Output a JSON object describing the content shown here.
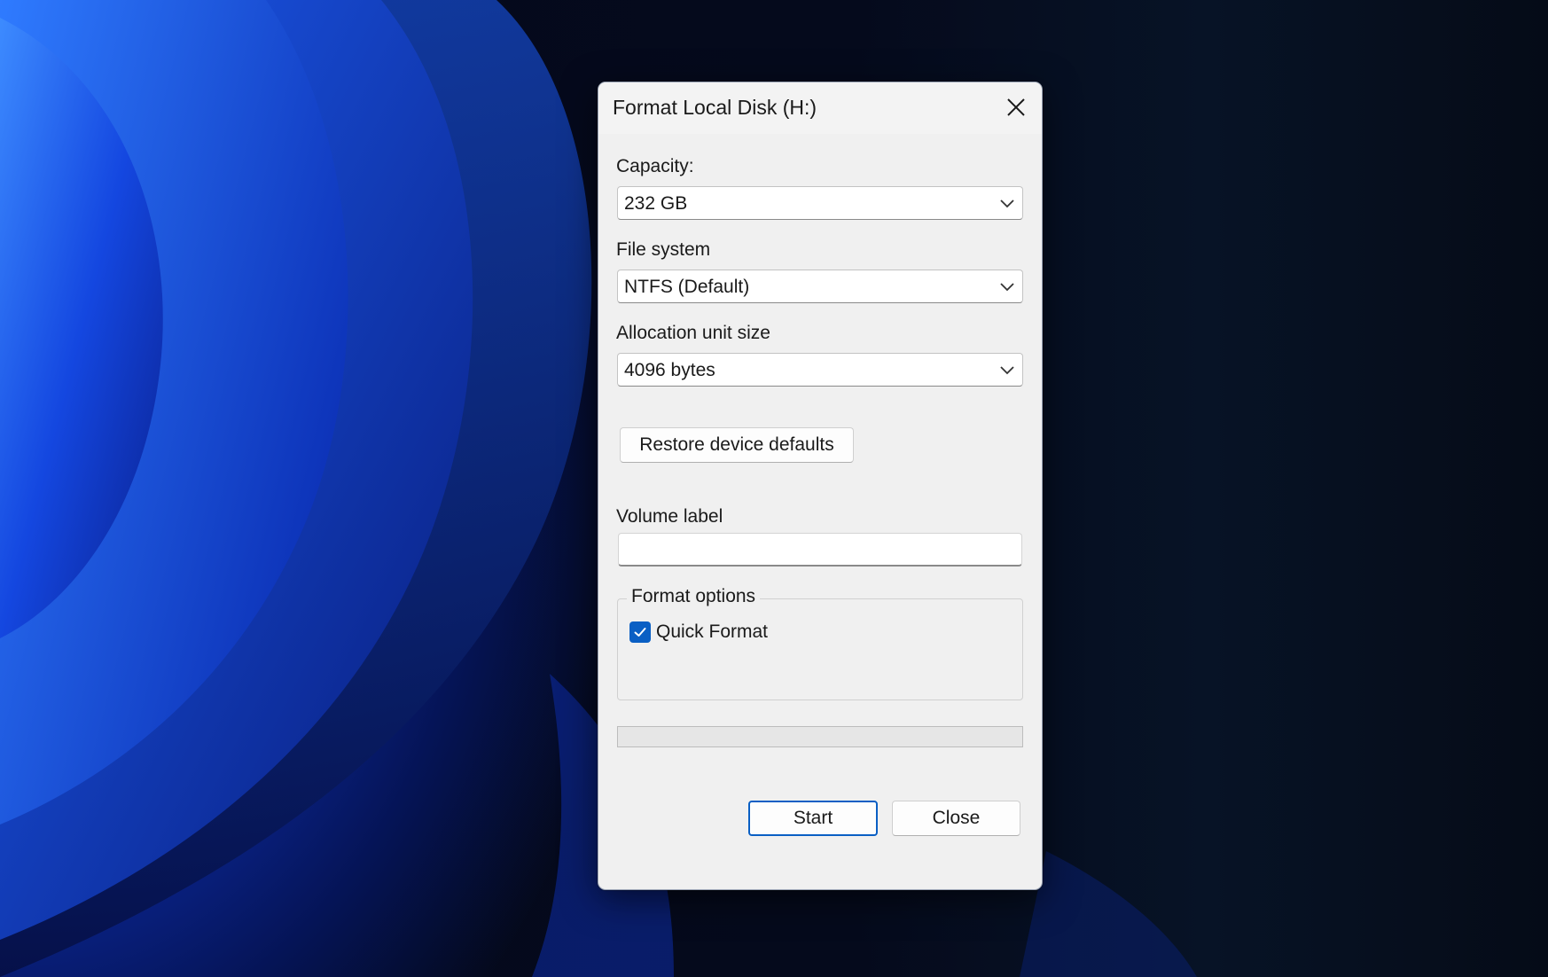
{
  "dialog": {
    "title": "Format Local Disk (H:)",
    "close_icon": "close-icon"
  },
  "capacity": {
    "label": "Capacity:",
    "value": "232 GB"
  },
  "file_system": {
    "label": "File system",
    "value": "NTFS (Default)"
  },
  "allocation": {
    "label": "Allocation unit size",
    "value": "4096 bytes"
  },
  "restore_button": {
    "label": "Restore device defaults"
  },
  "volume_label": {
    "label": "Volume label",
    "value": ""
  },
  "format_options": {
    "legend": "Format options",
    "quick_format": {
      "label": "Quick Format",
      "checked": true
    }
  },
  "progress": {
    "fraction": 0
  },
  "buttons": {
    "start": "Start",
    "close": "Close"
  },
  "colors": {
    "accent": "#0a5fc4",
    "dialog_bg": "#f0f0f0"
  }
}
